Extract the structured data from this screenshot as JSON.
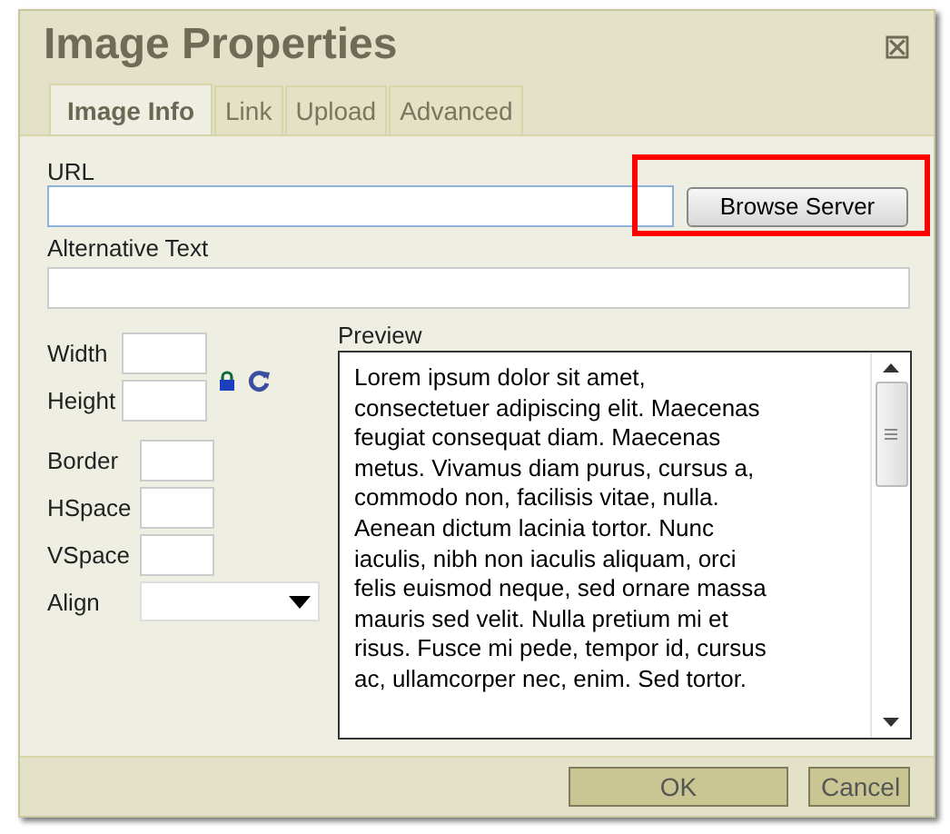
{
  "window": {
    "title": "Image Properties",
    "close": "⊠"
  },
  "tabs": [
    {
      "label": "Image Info",
      "selected": true
    },
    {
      "label": "Link",
      "selected": false
    },
    {
      "label": "Upload",
      "selected": false
    },
    {
      "label": "Advanced",
      "selected": false
    }
  ],
  "url": {
    "label": "URL",
    "button": "Browse Server",
    "highlighted": true
  },
  "alt": {
    "label": "Alternative Text"
  },
  "size_fields": [
    {
      "label": "Width"
    },
    {
      "label": "Height"
    }
  ],
  "spacing_fields": [
    {
      "label": "Border"
    },
    {
      "label": "HSpace"
    },
    {
      "label": "VSpace"
    }
  ],
  "align": {
    "label": "Align"
  },
  "preview": {
    "label": "Preview",
    "lines": [
      "Lorem ipsum dolor sit amet,",
      "consectetuer adipiscing elit. Maecenas",
      "feugiat consequat diam. Maecenas",
      "metus. Vivamus diam purus, cursus a,",
      "commodo non, facilisis vitae, nulla.",
      "Aenean dictum lacinia tortor. Nunc",
      "iaculis, nibh non iaculis aliquam, orci",
      "felis euismod neque, sed ornare massa",
      "mauris sed velit. Nulla pretium mi et",
      "risus. Fusce mi pede, tempor id, cursus",
      "ac, ullamcorper nec, enim. Sed tortor."
    ]
  },
  "buttons": [
    "OK",
    "Cancel"
  ]
}
